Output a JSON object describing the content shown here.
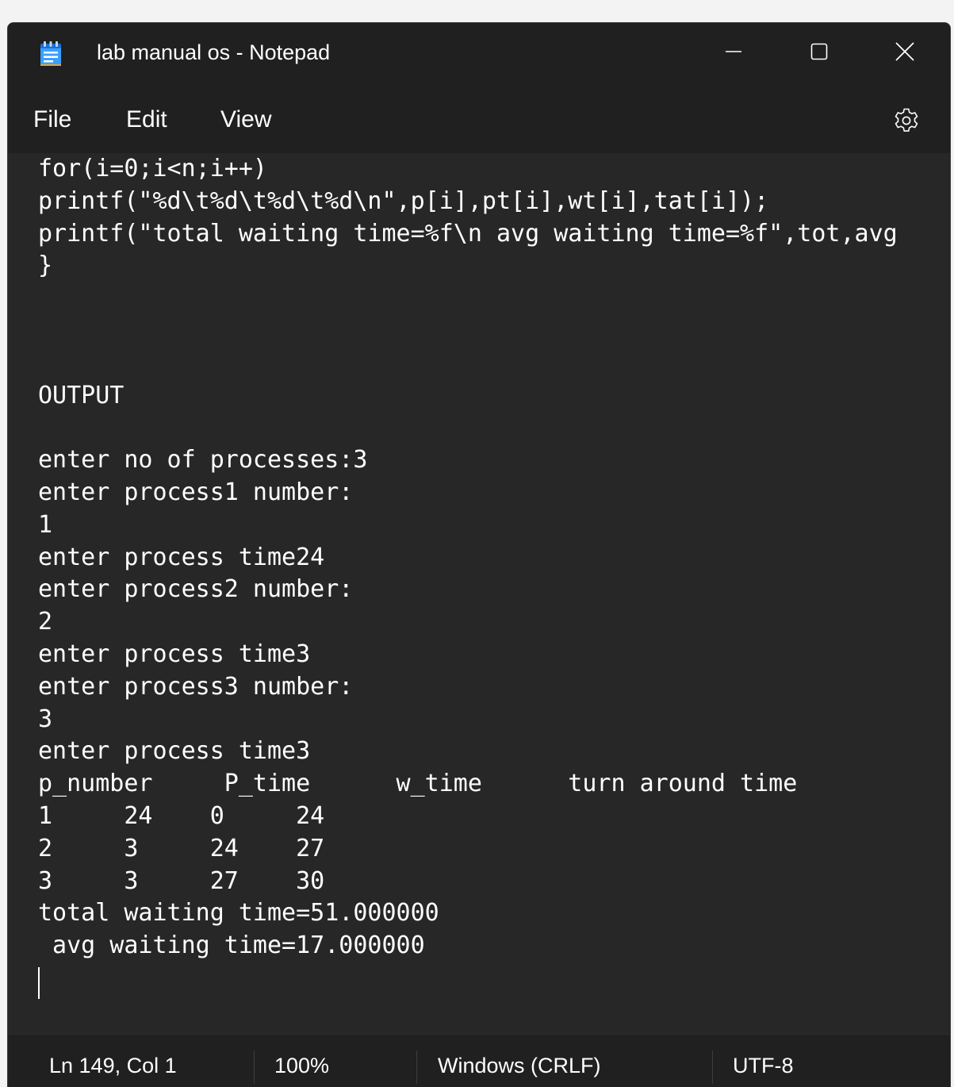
{
  "window": {
    "title": "lab manual os - Notepad",
    "minimize_icon": "minimize-icon",
    "maximize_icon": "maximize-icon",
    "close_icon": "close-icon",
    "app_icon": "notepad-icon"
  },
  "menu": {
    "file": "File",
    "edit": "Edit",
    "view": "View",
    "settings_icon": "gear-icon"
  },
  "editor": {
    "lines": [
      "for(i=0;i<n;i++)",
      "printf(\"%d\\t%d\\t%d\\t%d\\n\",p[i],pt[i],wt[i],tat[i]);",
      "printf(\"total waiting time=%f\\n avg waiting time=%f\",tot,avg",
      "}",
      "",
      "",
      "",
      "OUTPUT",
      "",
      "enter no of processes:3",
      "enter process1 number:",
      "1",
      "enter process time24",
      "enter process2 number:",
      "2",
      "enter process time3",
      "enter process3 number:",
      "3",
      "enter process time3",
      "p_number     P_time      w_time      turn around time",
      "1     24    0     24",
      "2     3     24    27",
      "3     3     27    30",
      "total waiting time=51.000000",
      " avg waiting time=17.000000"
    ]
  },
  "status": {
    "position": "Ln 149, Col 1",
    "zoom": "100%",
    "line_ending": "Windows (CRLF)",
    "encoding": "UTF-8"
  },
  "colors": {
    "background": "#202020",
    "editor_background": "#272727",
    "text": "#ffffff",
    "accent_icon": "#3aa0ff"
  }
}
